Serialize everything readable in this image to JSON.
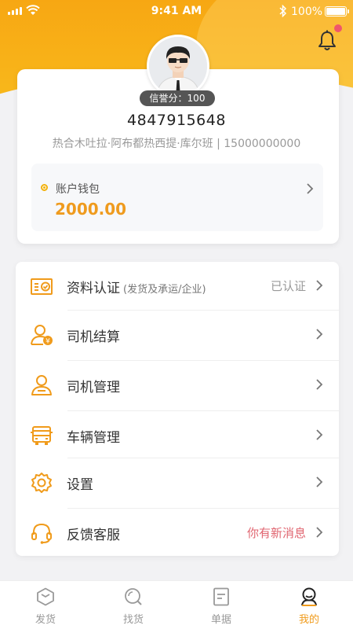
{
  "status_bar": {
    "time": "9:41 AM",
    "battery": "100%"
  },
  "profile": {
    "credit_label": "信誉分：",
    "credit_value": "100",
    "phone": "4847915648",
    "address": "热合木吐拉·阿布都热西提·库尔班 | 15000000000"
  },
  "wallet": {
    "label": "账户钱包",
    "amount": "2000.00"
  },
  "menu": [
    {
      "label": "资料认证",
      "sub": "(发货及承运/企业)",
      "status": "已认证",
      "icon": "id-card-icon"
    },
    {
      "label": "司机结算",
      "sub": "",
      "status": "",
      "icon": "driver-settlement-icon"
    },
    {
      "label": "司机管理",
      "sub": "",
      "status": "",
      "icon": "driver-icon"
    },
    {
      "label": "车辆管理",
      "sub": "",
      "status": "",
      "icon": "truck-icon"
    },
    {
      "label": "设置",
      "sub": "",
      "status": "",
      "icon": "gear-icon"
    },
    {
      "label": "反馈客服",
      "sub": "",
      "status": "你有新消息",
      "icon": "headset-icon"
    }
  ],
  "tabs": [
    {
      "label": "发货",
      "icon": "ship-box-icon",
      "active": false
    },
    {
      "label": "找货",
      "icon": "search-icon",
      "active": false
    },
    {
      "label": "单据",
      "icon": "document-icon",
      "active": false
    },
    {
      "label": "我的",
      "icon": "profile-icon",
      "active": true
    }
  ],
  "colors": {
    "accent": "#f7a713",
    "amount": "#ef9b1e",
    "alert": "#e06570",
    "notify_dot": "#f0566b"
  }
}
